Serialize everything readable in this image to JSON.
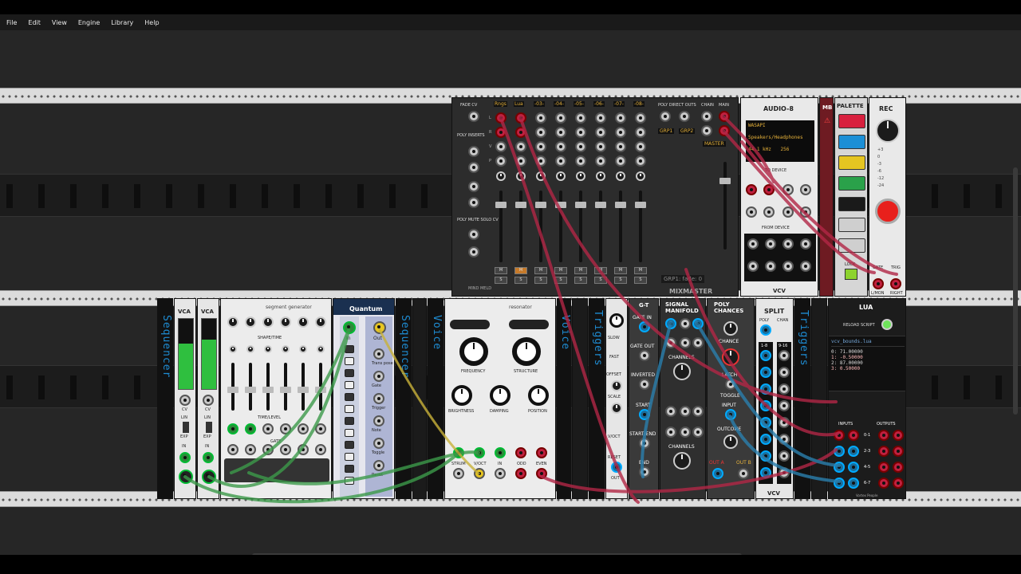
{
  "menubar": {
    "items": [
      "File",
      "Edit",
      "View",
      "Engine",
      "Library",
      "Help"
    ]
  },
  "mixmaster": {
    "title": "MIXMASTER",
    "brand": "MIND MELD",
    "fade_cv": "FADE CV",
    "fade_range": "1-8",
    "poly_inserts": "POLY INSERTS",
    "poly_mute": "POLY MUTE SOLO CV",
    "direct_outs": "POLY DIRECT OUTS",
    "chain": "CHAIN",
    "main": "MAIN",
    "master": "MASTER",
    "grp1": "GRP1",
    "grp2": "GRP2",
    "tooltip": "GRP1: fade: 0",
    "channels": [
      "Rngs",
      "Lua",
      "-03-",
      "-04-",
      "-05-",
      "-06-",
      "-07-",
      "-08-"
    ],
    "m_label": "M",
    "s_label": "S",
    "row_labels": [
      "L",
      "R",
      "V",
      "P"
    ]
  },
  "audio8": {
    "title": "AUDIO-8",
    "driver": "WASAPI",
    "device": "Speakers/Headphones",
    "rate": "44.1 kHz",
    "block": "256",
    "to_device": "TO DEVICE",
    "from_device": "FROM DEVICE",
    "brand": "VCV"
  },
  "mb": {
    "title": "MB"
  },
  "palette": {
    "title": "PALETTE",
    "lock": "LOCK",
    "colors": [
      "#d8203e",
      "#1b8fd6",
      "#e5c521",
      "#2aa14a",
      "#1a1a1a",
      "#cfcfcf",
      "#cfcfcf"
    ]
  },
  "rec": {
    "title": "REC",
    "gate": "GATE",
    "trig": "TRIG",
    "lmon": "L/MON",
    "right": "RIGHT",
    "brand": "VCV",
    "db_marks": [
      "+3",
      "0",
      "-3",
      "-6",
      "-12",
      "-24"
    ]
  },
  "vca1": {
    "title": "VCA",
    "cv": "CV",
    "lin": "LIN",
    "exp": "EXP",
    "in": "IN",
    "level_fill": 0.65
  },
  "vca2": {
    "title": "VCA",
    "cv": "CV",
    "lin": "LIN",
    "exp": "EXP",
    "in": "IN",
    "level_fill": 0.7
  },
  "segment_gen": {
    "title": "segment generator",
    "shape_time": "SHAPE/TIME",
    "time_level": "TIME/LEVEL",
    "gate": "GATE",
    "steps": [
      "1",
      "2",
      "3",
      "4",
      "5",
      "6"
    ]
  },
  "quantum": {
    "title": "Quantum",
    "in": "In",
    "out": "Out",
    "labels": [
      "Trans pose",
      "Gate",
      "Trigger",
      "Note",
      "Toggle",
      "Reset"
    ]
  },
  "seq_labels": {
    "left": "Sequencer",
    "mid": "Sequencer",
    "voice1": "Voice",
    "voice2": "Voice",
    "triggers1": "Triggers",
    "triggers2": "Triggers"
  },
  "resonator": {
    "title": "resonator",
    "frequency": "FREQUENCY",
    "structure": "STRUCTURE",
    "brightness": "BRIGHTNESS",
    "damping": "DAMPING",
    "position": "POSITION",
    "strum": "STRUM",
    "voct": "V/OCT",
    "in": "IN",
    "odd": "ODD",
    "even": "EVEN"
  },
  "gate_mod": {
    "title": "G-T",
    "slow": "SLOW",
    "fast": "FAST",
    "offset": "OFFSET",
    "scale": "SCALE",
    "voct": "V/OCT",
    "reset": "RESET",
    "out": "OUT"
  },
  "gate_cols": {
    "gate_in": "GATE IN",
    "gate_out": "GATE OUT",
    "inverted": "INVERTED",
    "start": "START",
    "start_end": "START/END",
    "end": "END"
  },
  "signal_manifold": {
    "title": "SIGNAL MANIFOLD",
    "channels1": "CHANNELS",
    "channels2": "CHANNELS"
  },
  "poly_chances": {
    "title": "POLY CHANCES",
    "chance": "CHANCE",
    "latch": "LATCH",
    "toggle": "TOGGLE",
    "input": "INPUT",
    "outcome": "OUTCOME",
    "out_a": "OUT A",
    "out_b": "OUT B"
  },
  "split": {
    "title": "SPLIT",
    "poly": "POLY",
    "chan": "CHAN",
    "brand": "VCV",
    "ranges": [
      "1-8",
      "9-16"
    ]
  },
  "lua": {
    "title": "LUA",
    "reload": "RELOAD SCRIPT",
    "file": "vcv_bounds.lua",
    "lines": [
      "0:  71.00000",
      "1:  -0.50000",
      "2:  87.00000",
      "3:   0.50000"
    ],
    "inputs": "INPUTS",
    "outputs": "OUTPUTS",
    "rows": [
      "0-1",
      "2-3",
      "4-5",
      "6-7"
    ],
    "footer": "Vortex People"
  }
}
